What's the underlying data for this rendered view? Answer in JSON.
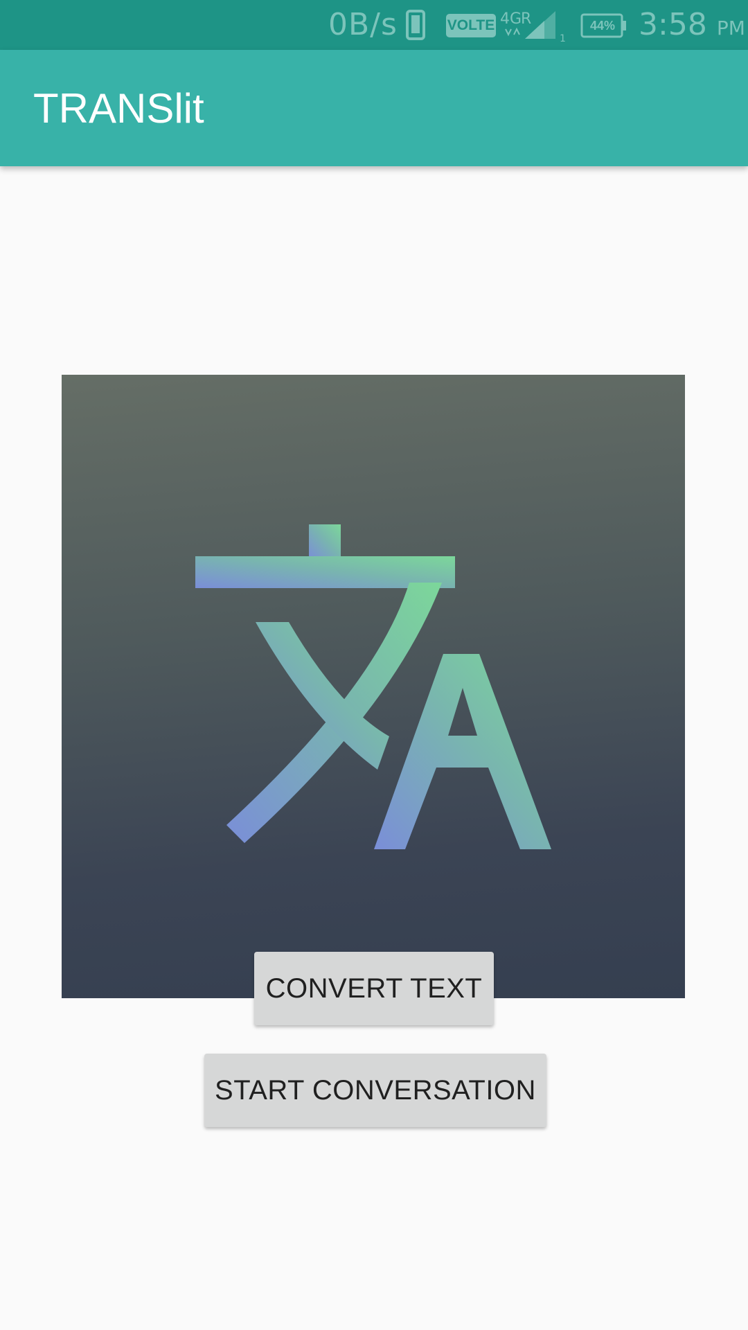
{
  "status_bar": {
    "net_speed": "0B/s",
    "volte": "VOLTE",
    "network_type": "4G",
    "battery_percent": "44%",
    "time": "3:58",
    "ampm": "PM"
  },
  "app_bar": {
    "title": "TRANSlit"
  },
  "hero": {
    "icon": "translate-icon"
  },
  "buttons": {
    "convert_text": "CONVERT TEXT",
    "start_conversation": "START CONVERSATION"
  },
  "colors": {
    "status_bar": "#1e9486",
    "app_bar": "#38b2a8",
    "background": "#fafafa",
    "button": "#d6d7d7"
  }
}
